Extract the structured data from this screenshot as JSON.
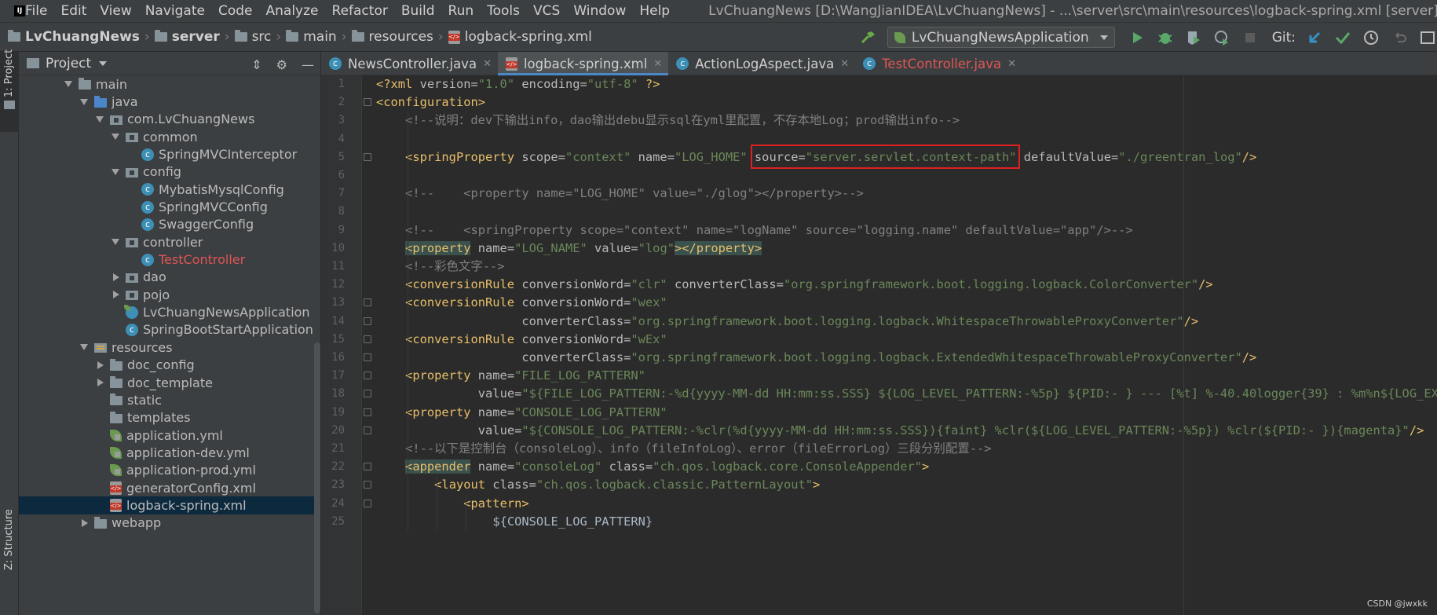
{
  "menubar": {
    "items": [
      "File",
      "Edit",
      "View",
      "Navigate",
      "Code",
      "Analyze",
      "Refactor",
      "Build",
      "Run",
      "Tools",
      "VCS",
      "Window",
      "Help"
    ],
    "window_title": "LvChuangNews [D:\\WangJianIDEA\\LvChuangNews] - ...\\server\\src\\main\\resources\\logback-spring.xml [server]"
  },
  "breadcrumb": [
    "LvChuangNews",
    "server",
    "src",
    "main",
    "resources",
    "logback-spring.xml"
  ],
  "toolbar": {
    "run_config": "LvChuangNewsApplication",
    "git_label": "Git:"
  },
  "stripe": {
    "project": "1: Project",
    "structure": "Z: Structure"
  },
  "project_panel": {
    "title": "Project",
    "tree": [
      {
        "label": "main",
        "depth": 0,
        "arrow": "down",
        "icon": "folder",
        "selected": false,
        "error": false
      },
      {
        "label": "java",
        "depth": 1,
        "arrow": "down",
        "icon": "srcfolder",
        "selected": false,
        "error": false
      },
      {
        "label": "com.LvChuangNews",
        "depth": 2,
        "arrow": "down",
        "icon": "package",
        "selected": false,
        "error": false
      },
      {
        "label": "common",
        "depth": 3,
        "arrow": "down",
        "icon": "package",
        "selected": false,
        "error": false
      },
      {
        "label": "SpringMVCInterceptor",
        "depth": 4,
        "arrow": "none",
        "icon": "class",
        "selected": false,
        "error": false
      },
      {
        "label": "config",
        "depth": 3,
        "arrow": "down",
        "icon": "package",
        "selected": false,
        "error": false
      },
      {
        "label": "MybatisMysqlConfig",
        "depth": 4,
        "arrow": "none",
        "icon": "class",
        "selected": false,
        "error": false
      },
      {
        "label": "SpringMVCConfig",
        "depth": 4,
        "arrow": "none",
        "icon": "class",
        "selected": false,
        "error": false
      },
      {
        "label": "SwaggerConfig",
        "depth": 4,
        "arrow": "none",
        "icon": "class",
        "selected": false,
        "error": false
      },
      {
        "label": "controller",
        "depth": 3,
        "arrow": "down",
        "icon": "package",
        "selected": false,
        "error": false
      },
      {
        "label": "TestController",
        "depth": 4,
        "arrow": "none",
        "icon": "class",
        "selected": false,
        "error": true
      },
      {
        "label": "dao",
        "depth": 3,
        "arrow": "right",
        "icon": "package",
        "selected": false,
        "error": false
      },
      {
        "label": "pojo",
        "depth": 3,
        "arrow": "right",
        "icon": "package",
        "selected": false,
        "error": false
      },
      {
        "label": "LvChuangNewsApplication",
        "depth": 3,
        "arrow": "none",
        "icon": "springclass",
        "selected": false,
        "error": false
      },
      {
        "label": "SpringBootStartApplication",
        "depth": 3,
        "arrow": "none",
        "icon": "class",
        "selected": false,
        "error": false
      },
      {
        "label": "resources",
        "depth": 1,
        "arrow": "down",
        "icon": "resfolder",
        "selected": false,
        "error": false
      },
      {
        "label": "doc_config",
        "depth": 2,
        "arrow": "right",
        "icon": "folder",
        "selected": false,
        "error": false
      },
      {
        "label": "doc_template",
        "depth": 2,
        "arrow": "right",
        "icon": "folder",
        "selected": false,
        "error": false
      },
      {
        "label": "static",
        "depth": 2,
        "arrow": "none",
        "icon": "folder",
        "selected": false,
        "error": false
      },
      {
        "label": "templates",
        "depth": 2,
        "arrow": "none",
        "icon": "folder",
        "selected": false,
        "error": false
      },
      {
        "label": "application.yml",
        "depth": 2,
        "arrow": "none",
        "icon": "yml",
        "selected": false,
        "error": false
      },
      {
        "label": "application-dev.yml",
        "depth": 2,
        "arrow": "none",
        "icon": "yml",
        "selected": false,
        "error": false
      },
      {
        "label": "application-prod.yml",
        "depth": 2,
        "arrow": "none",
        "icon": "yml",
        "selected": false,
        "error": false
      },
      {
        "label": "generatorConfig.xml",
        "depth": 2,
        "arrow": "none",
        "icon": "xml",
        "selected": false,
        "error": false
      },
      {
        "label": "logback-spring.xml",
        "depth": 2,
        "arrow": "none",
        "icon": "xml",
        "selected": true,
        "error": false
      },
      {
        "label": "webapp",
        "depth": 1,
        "arrow": "right",
        "icon": "folder",
        "selected": false,
        "error": false
      }
    ]
  },
  "tabs": [
    {
      "label": "NewsController.java",
      "icon": "class",
      "active": false,
      "error": false
    },
    {
      "label": "logback-spring.xml",
      "icon": "xml",
      "active": true,
      "error": false
    },
    {
      "label": "ActionLogAspect.java",
      "icon": "class",
      "active": false,
      "error": false
    },
    {
      "label": "TestController.java",
      "icon": "class",
      "active": false,
      "error": true
    }
  ],
  "editor": {
    "lines": [
      {
        "n": "1",
        "indent": 0,
        "parts": [
          [
            "proc",
            "<?xml "
          ],
          [
            "attr",
            "version="
          ],
          [
            "val",
            "\"1.0\""
          ],
          [
            "attr",
            " encoding="
          ],
          [
            "val",
            "\"utf-8\""
          ],
          [
            "proc",
            " ?>"
          ]
        ]
      },
      {
        "n": "2",
        "indent": 0,
        "parts": [
          [
            "tag",
            "<configuration>"
          ]
        ]
      },
      {
        "n": "3",
        "indent": 1,
        "parts": [
          [
            "cmt",
            "<!--说明：dev下输出info，dao输出debu显示sql在yml里配置，不存本地Log；prod输出info-->"
          ]
        ]
      },
      {
        "n": "4",
        "indent": 0,
        "parts": []
      },
      {
        "n": "5",
        "indent": 1,
        "parts": [
          [
            "tag",
            "<springProperty "
          ],
          [
            "attr",
            "scope="
          ],
          [
            "val",
            "\"context\""
          ],
          [
            "attr",
            " name="
          ],
          [
            "val",
            "\"LOG_HOME\""
          ],
          [
            "attr",
            " source="
          ],
          [
            "val",
            "\"server.servlet.context-path\""
          ],
          [
            "attr",
            " defaultValue="
          ],
          [
            "val",
            "\"./greentran_log\""
          ],
          [
            "tag",
            "/>"
          ]
        ]
      },
      {
        "n": "6",
        "indent": 0,
        "parts": []
      },
      {
        "n": "7",
        "indent": 1,
        "parts": [
          [
            "cmt",
            "<!--    <property name=\"LOG_HOME\" value=\"./glog\"></property>-->"
          ]
        ]
      },
      {
        "n": "8",
        "indent": 0,
        "parts": []
      },
      {
        "n": "9",
        "indent": 1,
        "parts": [
          [
            "cmt",
            "<!--    <springProperty scope=\"context\" name=\"logName\" source=\"logging.name\" defaultValue=\"app\"/>-->"
          ]
        ]
      },
      {
        "n": "10",
        "indent": 1,
        "parts": [
          [
            "tagHL",
            "<property"
          ],
          [
            "attr",
            " name="
          ],
          [
            "val",
            "\"LOG_NAME\""
          ],
          [
            "attr",
            " value="
          ],
          [
            "val",
            "\"log\""
          ],
          [
            "tagHL",
            "></property>"
          ]
        ]
      },
      {
        "n": "11",
        "indent": 1,
        "parts": [
          [
            "cmt",
            "<!--彩色文字-->"
          ]
        ]
      },
      {
        "n": "12",
        "indent": 1,
        "parts": [
          [
            "tag",
            "<conversionRule "
          ],
          [
            "attr",
            "conversionWord="
          ],
          [
            "val",
            "\"clr\""
          ],
          [
            "attr",
            " converterClass="
          ],
          [
            "val",
            "\"org.springframework.boot.logging.logback.ColorConverter\""
          ],
          [
            "tag",
            "/>"
          ]
        ]
      },
      {
        "n": "13",
        "indent": 1,
        "parts": [
          [
            "tag",
            "<conversionRule "
          ],
          [
            "attr",
            "conversionWord="
          ],
          [
            "val",
            "\"wex\""
          ]
        ]
      },
      {
        "n": "14",
        "indent": 5,
        "parts": [
          [
            "attr",
            "converterClass="
          ],
          [
            "val",
            "\"org.springframework.boot.logging.logback.WhitespaceThrowableProxyConverter\""
          ],
          [
            "tag",
            "/>"
          ]
        ]
      },
      {
        "n": "15",
        "indent": 1,
        "parts": [
          [
            "tag",
            "<conversionRule "
          ],
          [
            "attr",
            "conversionWord="
          ],
          [
            "val",
            "\"wEx\""
          ]
        ]
      },
      {
        "n": "16",
        "indent": 5,
        "parts": [
          [
            "attr",
            "converterClass="
          ],
          [
            "val",
            "\"org.springframework.boot.logging.logback.ExtendedWhitespaceThrowableProxyConverter\""
          ],
          [
            "tag",
            "/>"
          ]
        ]
      },
      {
        "n": "17",
        "indent": 1,
        "parts": [
          [
            "tag",
            "<property "
          ],
          [
            "attr",
            "name="
          ],
          [
            "val",
            "\"FILE_LOG_PATTERN\""
          ]
        ]
      },
      {
        "n": "18",
        "indent": 3.5,
        "parts": [
          [
            "attr",
            "value="
          ],
          [
            "val",
            "\"${FILE_LOG_PATTERN:-%d{yyyy-MM-dd HH:mm:ss.SSS} ${LOG_LEVEL_PATTERN:-%5p} ${PID:- } --- [%t] %-40.40logger{39} : %m%n${LOG_EXCEPTION_CONVERSION_WORD:-%wEx}}\""
          ],
          [
            "tag",
            "/>"
          ]
        ]
      },
      {
        "n": "19",
        "indent": 1,
        "parts": [
          [
            "tag",
            "<property "
          ],
          [
            "attr",
            "name="
          ],
          [
            "val",
            "\"CONSOLE_LOG_PATTERN\""
          ]
        ]
      },
      {
        "n": "20",
        "indent": 3.5,
        "parts": [
          [
            "attr",
            "value="
          ],
          [
            "val",
            "\"${CONSOLE_LOG_PATTERN:-%clr(%d{yyyy-MM-dd HH:mm:ss.SSS}){faint} %clr(${LOG_LEVEL_PATTERN:-%5p}) %clr(${PID:- }){magenta}\""
          ],
          [
            "tag",
            "/>"
          ]
        ]
      },
      {
        "n": "21",
        "indent": 1,
        "parts": [
          [
            "cmt",
            "<!--以下是控制台（consoleLog）、info（fileInfoLog）、error（fileErrorLog）三段分别配置-->"
          ]
        ]
      },
      {
        "n": "22",
        "indent": 1,
        "parts": [
          [
            "tagHL",
            "<appender"
          ],
          [
            "attr",
            " name="
          ],
          [
            "val",
            "\"consoleLog\""
          ],
          [
            "attr",
            " class="
          ],
          [
            "val",
            "\"ch.qos.logback.core.ConsoleAppender\""
          ],
          [
            "tag",
            ">"
          ]
        ]
      },
      {
        "n": "23",
        "indent": 2,
        "parts": [
          [
            "tag",
            "<layout "
          ],
          [
            "attr",
            "class="
          ],
          [
            "val",
            "\"ch.qos.logback.classic.PatternLayout\""
          ],
          [
            "tag",
            ">"
          ]
        ]
      },
      {
        "n": "24",
        "indent": 3,
        "parts": [
          [
            "tag",
            "<pattern>"
          ]
        ]
      },
      {
        "n": "25",
        "indent": 4,
        "parts": [
          [
            "text",
            "${CONSOLE_LOG_PATTERN}"
          ]
        ]
      }
    ],
    "fold_markers": [
      "2",
      "5",
      "13",
      "14",
      "15",
      "16",
      "17",
      "18",
      "19",
      "20",
      "22",
      "23",
      "24"
    ]
  },
  "watermark": "CSDN @jwxkk",
  "colors": {
    "tag": "#e8bf6a",
    "attr": "#bababa",
    "value": "#6a8759",
    "comment": "#808080",
    "highlight_box": "#e02020",
    "selection": "#0d293e"
  }
}
